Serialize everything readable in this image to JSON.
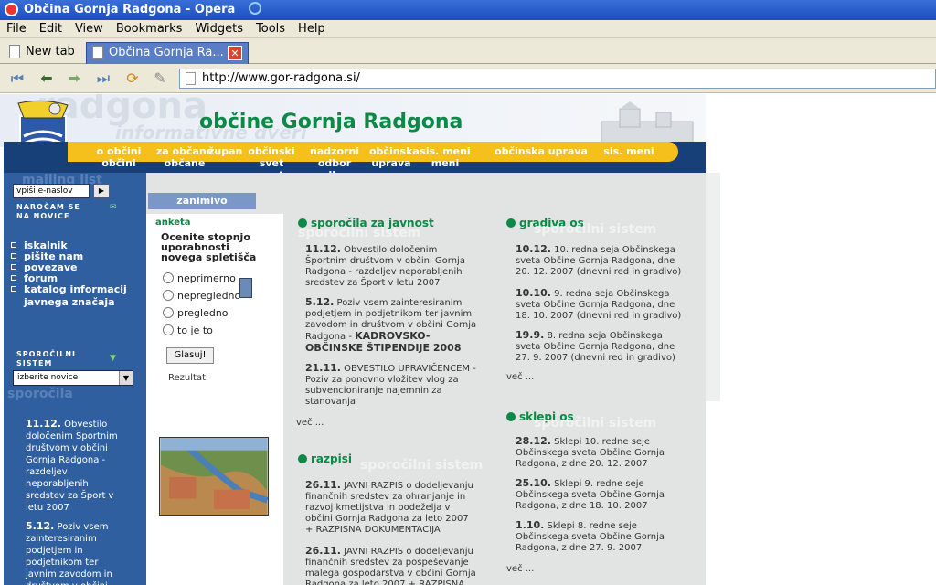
{
  "window": {
    "title": "Občina Gornja Radgona - Opera"
  },
  "menu": [
    "File",
    "Edit",
    "View",
    "Bookmarks",
    "Widgets",
    "Tools",
    "Help"
  ],
  "tabs": [
    {
      "label": "New tab"
    },
    {
      "label": "Občina Gornja Ra..."
    }
  ],
  "address": {
    "url": "http://www.gor-radgona.si/"
  },
  "header": {
    "title": "občine Gornja Radgona",
    "watermark_top": "radgona",
    "watermark_sub": "informativne dveri"
  },
  "topnav": [
    "o občini",
    "občini",
    "za občane",
    "občane",
    "župan",
    "občinski svet",
    "svet",
    "nadzorni odbor",
    "odbor",
    "občinska uprava",
    "uprava",
    "sis. meni",
    "meni",
    "občinska uprava",
    "sis. meni"
  ],
  "left": {
    "watermark_mailing": "mailing list",
    "email_placeholder": "vpiši e-naslov",
    "subscribe_label": "NAROČAM SE NA NOVICE",
    "links": [
      "iskalnik",
      "pišite nam",
      "povezave",
      "forum",
      "katalog informacij",
      "javnega značaja"
    ],
    "notif_label": "SPOROČILNI SISTEM",
    "watermark_sporocila": "sporočila",
    "select_value": "izberite novice",
    "news": [
      {
        "date": "11.12.",
        "text": "Obvestilo določenim Športnim društvom v občini Gornja Radgona - razdeljev neporabljenih sredstev za Šport v letu 2007"
      },
      {
        "date": "5.12.",
        "text": "Poziv vsem zainteresiranim podjetjem in podjetnikom ter javnim zavodom in društvom v občini Gornja"
      }
    ]
  },
  "poll": {
    "tab_label": "zanimivo",
    "heading": "anketa",
    "question": "Ocenite stopnjo uporabnosti novega spletišča",
    "options": [
      "neprimerno",
      "nepregledno",
      "pregledno",
      "to je to"
    ],
    "vote_label": "Glasuj!",
    "results_label": "Rezultati"
  },
  "sections": {
    "sporocila": {
      "title": "sporočila za javnost",
      "watermark": "sporočilni sistem",
      "items": [
        {
          "date": "11.12.",
          "text": "Obvestilo določenim Športnim društvom v občini Gornja Radgona - razdeljev neporabljenih sredstev za Šport v letu 2007"
        },
        {
          "date": "5.12.",
          "text": "Poziv vsem zainteresiranim podjetjem in podjetnikom ter javnim zavodom in društvom v občini Gornja Radgona -",
          "bold": "KADROVSKO-OBČINSKE ŠTIPENDIJE 2008"
        },
        {
          "date": "21.11.",
          "text": "OBVESTILO UPRAVIČENCEM - Poziv za ponovno vložitev vlog za subvencioniranje najemnin za stanovanja"
        }
      ],
      "more": "več ..."
    },
    "gradiva": {
      "title": "gradiva os",
      "watermark": "sporočilni sistem",
      "items": [
        {
          "date": "10.12.",
          "text": "10. redna seja Občinskega sveta Občine Gornja Radgona, dne 20. 12. 2007 (dnevni red in gradivo)"
        },
        {
          "date": "10.10.",
          "text": "9. redna seja Občinskega sveta Občine Gornja Radgona, dne 18. 10. 2007 (dnevni red in gradivo)"
        },
        {
          "date": "19.9.",
          "text": "8. redna seja Občinskega sveta Občine Gornja Radgona, dne 27. 9. 2007 (dnevni red in gradivo)"
        }
      ],
      "more": "več ..."
    },
    "sklepi": {
      "title": "sklepi os",
      "watermark": "sporočilni sistem",
      "items": [
        {
          "date": "28.12.",
          "text": "Sklepi 10. redne seje Občinskega sveta Občine Gornja Radgona, z dne 20. 12. 2007"
        },
        {
          "date": "25.10.",
          "text": "Sklepi 9. redne seje Občinskega sveta Občine Gornja Radgona, z dne 18. 10. 2007"
        },
        {
          "date": "1.10.",
          "text": "Sklepi 8. redne seje Občinskega sveta Občine Gornja Radgona, z dne 27. 9. 2007"
        }
      ],
      "more": "več ..."
    },
    "razpisi": {
      "title": "razpisi",
      "watermark": "sporočilni sistem",
      "items": [
        {
          "date": "26.11.",
          "text": "JAVNI RAZPIS o dodeljevanju finančnih sredstev za ohranjanje in razvoj kmetijstva in podeželja v občini Gornja Radgona za leto 2007 + RAZPISNA DOKUMENTACIJA"
        },
        {
          "date": "26.11.",
          "text": "JAVNI RAZPIS o dodeljevanju finančnih sredstev za pospeševanje malega gospodarstva v občini Gornja Radgona za leto 2007 + RAZPISNA"
        }
      ]
    }
  }
}
